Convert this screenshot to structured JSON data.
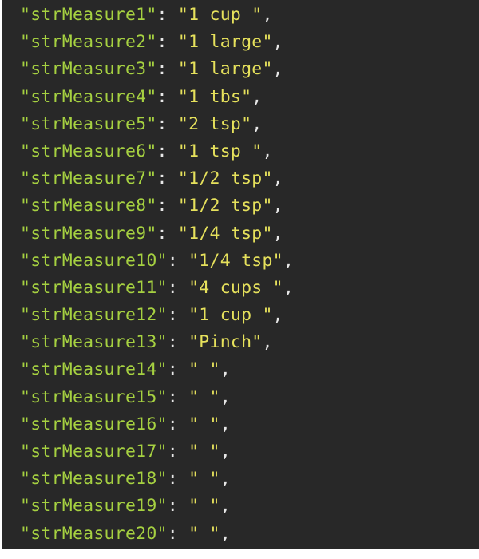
{
  "code": {
    "colors": {
      "background": "#282828",
      "key": "#a6d141",
      "value": "#e6e15c",
      "punctuation": "#e8e8e8"
    },
    "lines": [
      {
        "key": "\"strMeasure1\"",
        "value": "\"1 cup \""
      },
      {
        "key": "\"strMeasure2\"",
        "value": "\"1 large\""
      },
      {
        "key": "\"strMeasure3\"",
        "value": "\"1 large\""
      },
      {
        "key": "\"strMeasure4\"",
        "value": "\"1 tbs\""
      },
      {
        "key": "\"strMeasure5\"",
        "value": "\"2 tsp\""
      },
      {
        "key": "\"strMeasure6\"",
        "value": "\"1 tsp \""
      },
      {
        "key": "\"strMeasure7\"",
        "value": "\"1/2 tsp\""
      },
      {
        "key": "\"strMeasure8\"",
        "value": "\"1/2 tsp\""
      },
      {
        "key": "\"strMeasure9\"",
        "value": "\"1/4 tsp\""
      },
      {
        "key": "\"strMeasure10\"",
        "value": "\"1/4 tsp\""
      },
      {
        "key": "\"strMeasure11\"",
        "value": "\"4 cups \""
      },
      {
        "key": "\"strMeasure12\"",
        "value": "\"1 cup \""
      },
      {
        "key": "\"strMeasure13\"",
        "value": "\"Pinch\""
      },
      {
        "key": "\"strMeasure14\"",
        "value": "\" \""
      },
      {
        "key": "\"strMeasure15\"",
        "value": "\" \""
      },
      {
        "key": "\"strMeasure16\"",
        "value": "\" \""
      },
      {
        "key": "\"strMeasure17\"",
        "value": "\" \""
      },
      {
        "key": "\"strMeasure18\"",
        "value": "\" \""
      },
      {
        "key": "\"strMeasure19\"",
        "value": "\" \""
      },
      {
        "key": "\"strMeasure20\"",
        "value": "\" \""
      }
    ]
  }
}
